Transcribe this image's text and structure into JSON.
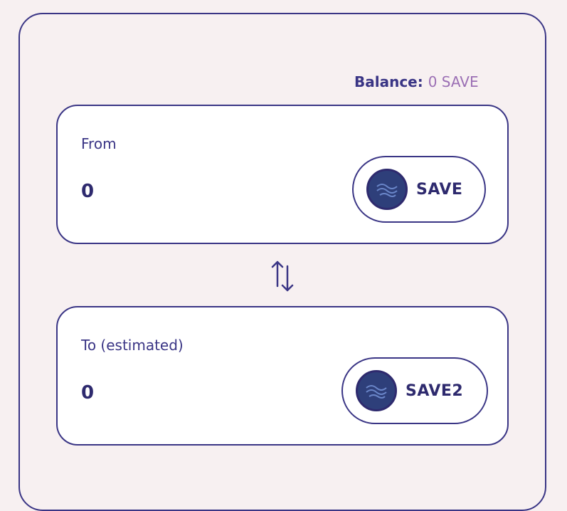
{
  "balance": {
    "label": "Balance:",
    "value": "0 SAVE"
  },
  "from": {
    "label": "From",
    "amount": "0",
    "token": "SAVE",
    "token_icon": "wave-token-icon"
  },
  "to": {
    "label": "To (estimated)",
    "amount": "0",
    "token": "SAVE2",
    "token_icon": "wave-token-icon"
  },
  "swap_icon": "swap-arrows-icon",
  "colors": {
    "accent": "#3a3585",
    "text": "#2e2a6e",
    "balance_value": "#9b6fb4",
    "background": "#f7f0f1",
    "token_fill": "#2e3f7a"
  }
}
